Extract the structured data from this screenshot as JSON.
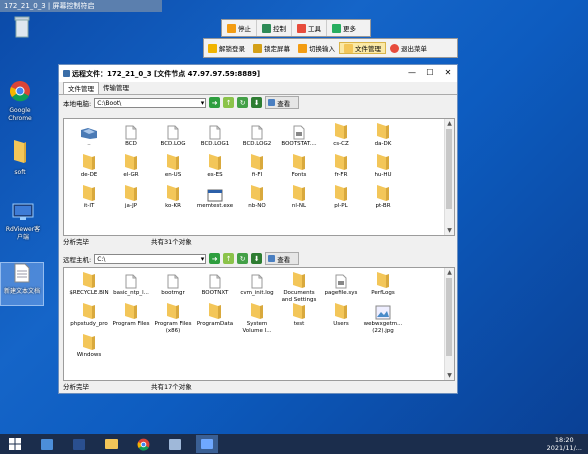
{
  "remote_bar": {
    "title": "172_21_0_3 | 屏幕控制符启"
  },
  "toolbar": {
    "stop": "停止",
    "control": "控制",
    "tools": "工具",
    "more": "更多"
  },
  "toolbar2": {
    "login": "解锁登录",
    "lock": "锁定屏幕",
    "switch_input": "切换输入",
    "file_mgr": "文件管理",
    "exit": "退出菜单"
  },
  "desktop": {
    "chrome_label1": "Google",
    "chrome_label2": "Chrome",
    "soft_label": "soft",
    "rdviewer_label1": "RdViewer客",
    "rdviewer_label2": "户端",
    "newtext_label": "新建文本文档"
  },
  "window": {
    "title": "远程文件：172_21_0_3 [文件节点 47.97.97.59:8889]",
    "tabs": [
      "文件管理",
      "传输管理"
    ],
    "local": {
      "label": "本地电脑:",
      "path": "C:\\Boot\\",
      "view": "查看",
      "items": [
        {
          "name": "..",
          "type": "up"
        },
        {
          "name": "BCD",
          "type": "file"
        },
        {
          "name": "BCD.LOG",
          "type": "file"
        },
        {
          "name": "BCD.LOG1",
          "type": "file"
        },
        {
          "name": "BCD.LOG2",
          "type": "file"
        },
        {
          "name": "BOOTSTAT....",
          "type": "dat"
        },
        {
          "name": "cs-CZ",
          "type": "folder"
        },
        {
          "name": "da-DK",
          "type": "folder"
        },
        {
          "name": "",
          "type": "none"
        },
        {
          "name": "de-DE",
          "type": "folder"
        },
        {
          "name": "el-GR",
          "type": "folder"
        },
        {
          "name": "en-US",
          "type": "folder"
        },
        {
          "name": "es-ES",
          "type": "folder"
        },
        {
          "name": "fi-FI",
          "type": "folder"
        },
        {
          "name": "Fonts",
          "type": "folder"
        },
        {
          "name": "fr-FR",
          "type": "folder"
        },
        {
          "name": "hu-HU",
          "type": "folder"
        },
        {
          "name": "",
          "type": "none"
        },
        {
          "name": "it-IT",
          "type": "folder"
        },
        {
          "name": "ja-JP",
          "type": "folder"
        },
        {
          "name": "ko-KR",
          "type": "folder"
        },
        {
          "name": "memtest.exe",
          "type": "exe"
        },
        {
          "name": "nb-NO",
          "type": "folder"
        },
        {
          "name": "nl-NL",
          "type": "folder"
        },
        {
          "name": "pl-PL",
          "type": "folder"
        },
        {
          "name": "pt-BR",
          "type": "folder"
        }
      ],
      "status_left": "分析完毕",
      "status_right": "共有31个对象"
    },
    "remote": {
      "label": "远程主机:",
      "path": "C:\\",
      "view": "查看",
      "items": [
        {
          "name": "$RECYCLE.BIN",
          "type": "folder"
        },
        {
          "name": "basic_ntp_l...",
          "type": "file"
        },
        {
          "name": "bootmgr",
          "type": "file"
        },
        {
          "name": "BOOTNXT",
          "type": "file"
        },
        {
          "name": "cvm_init.log",
          "type": "file"
        },
        {
          "name": "Documents and Settings",
          "type": "folder"
        },
        {
          "name": "pagefile.sys",
          "type": "dat"
        },
        {
          "name": "PerfLogs",
          "type": "folder"
        },
        {
          "name": "",
          "type": "none"
        },
        {
          "name": "phpstudy_pro",
          "type": "folder"
        },
        {
          "name": "Program Files",
          "type": "folder"
        },
        {
          "name": "Program Files (x86)",
          "type": "folder"
        },
        {
          "name": "ProgramData",
          "type": "folder"
        },
        {
          "name": "System Volume I...",
          "type": "folder"
        },
        {
          "name": "test",
          "type": "folder"
        },
        {
          "name": "Users",
          "type": "folder"
        },
        {
          "name": "webwxgetm... (22).jpg",
          "type": "img"
        },
        {
          "name": "",
          "type": "none"
        },
        {
          "name": "Windows",
          "type": "folder"
        }
      ],
      "status_left": "分析完毕",
      "status_right": "共有17个对象"
    }
  },
  "clock": {
    "time": "18:20",
    "date": "2021/11/..."
  },
  "colors": {
    "folder": "#f3c659",
    "accent": "#1b2d4c"
  }
}
